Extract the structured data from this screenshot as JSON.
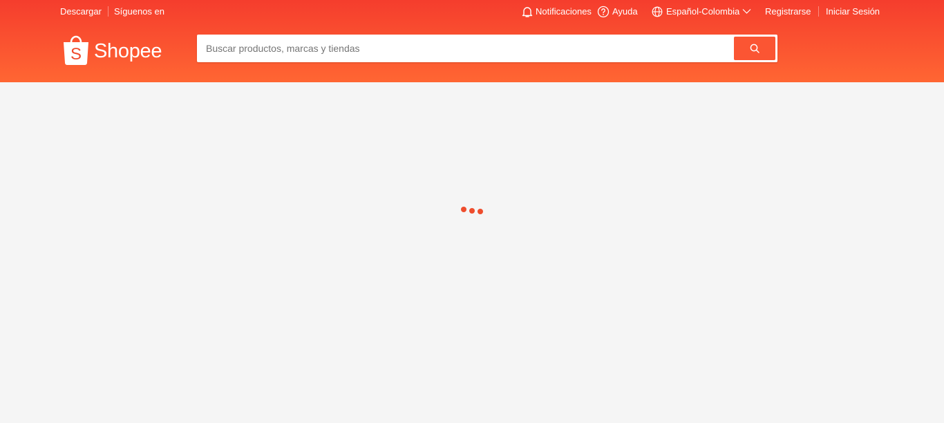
{
  "topbar": {
    "download": "Descargar",
    "follow": "Síguenos en",
    "notifications": "Notificaciones",
    "help": "Ayuda",
    "language": "Español-Colombia",
    "register": "Registrarse",
    "login": "Iniciar Sesión"
  },
  "brand": {
    "name": "Shopee"
  },
  "search": {
    "placeholder": "Buscar productos, marcas y tiendas",
    "value": ""
  },
  "icons": {
    "notifications": "bell-icon",
    "help": "question-circle-icon",
    "language": "globe-icon",
    "language_dropdown": "chevron-down-icon",
    "search": "search-icon",
    "logo": "shopping-bag-icon"
  },
  "colors": {
    "header_top": "#f53d2d",
    "header_bottom": "#ff6633",
    "accent": "#ee4d2d",
    "search_button": "#fb5533",
    "page_background": "#f5f5f5"
  }
}
